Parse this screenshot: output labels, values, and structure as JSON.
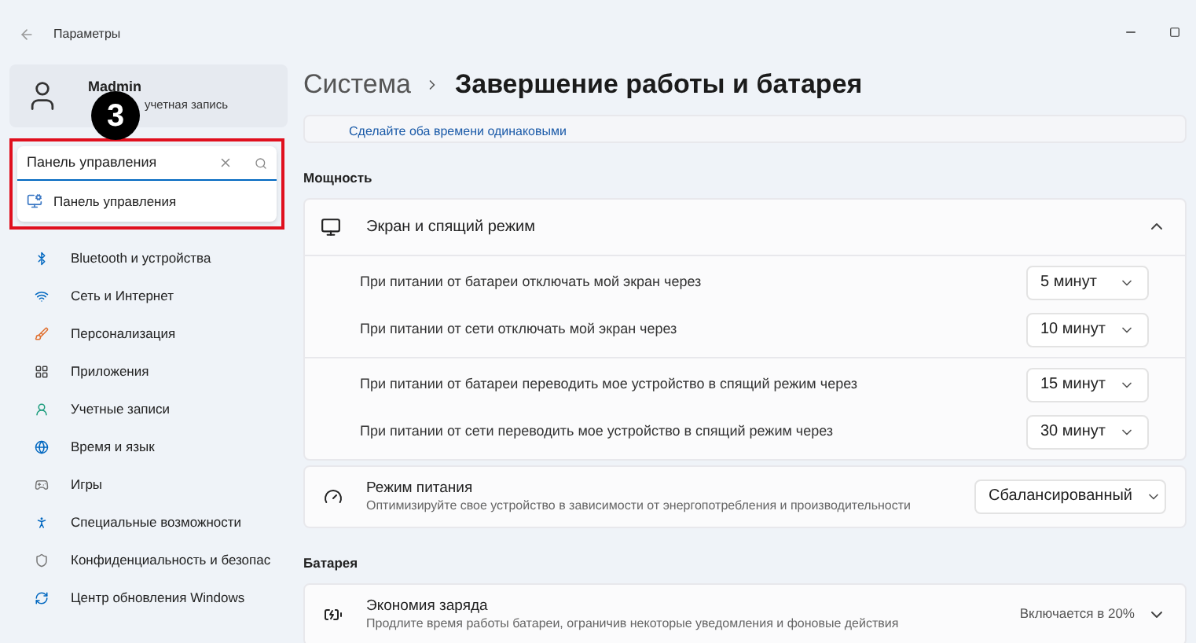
{
  "window": {
    "title": "Параметры"
  },
  "account": {
    "name": "Madmin",
    "subtitle": "учетная запись"
  },
  "step_badge": "3",
  "search": {
    "value": "Панель управления",
    "suggestions": [
      "Панель управления"
    ]
  },
  "nav": [
    {
      "label": "Bluetooth и устройства"
    },
    {
      "label": "Сеть и Интернет"
    },
    {
      "label": "Персонализация"
    },
    {
      "label": "Приложения"
    },
    {
      "label": "Учетные записи"
    },
    {
      "label": "Время и язык"
    },
    {
      "label": "Игры"
    },
    {
      "label": "Специальные возможности"
    },
    {
      "label": "Конфиденциальность и безопас"
    },
    {
      "label": "Центр обновления Windows"
    }
  ],
  "breadcrumb": {
    "parent": "Система",
    "current": "Завершение работы и батарея"
  },
  "link": "Сделайте оба времени одинаковыми",
  "sections": [
    {
      "title": "Мощность",
      "cards": [
        {
          "kind": "expander",
          "title": "Экран и спящий режим",
          "expanded": true,
          "groups": [
            [
              {
                "label": "При питании от батареи отключать мой экран через",
                "value": "5 минут"
              },
              {
                "label": "При питании от сети отключать мой экран через",
                "value": "10 минут"
              }
            ],
            [
              {
                "label": "При питании от батареи переводить мое устройство в спящий режим через",
                "value": "15 минут"
              },
              {
                "label": "При питании от сети переводить мое устройство в спящий режим через",
                "value": "30 минут"
              }
            ]
          ]
        },
        {
          "kind": "select",
          "title": "Режим питания",
          "description": "Оптимизируйте свое устройство в зависимости от энергопотребления и производительности",
          "value": "Сбалансированный"
        }
      ]
    },
    {
      "title": "Батарея",
      "cards": [
        {
          "kind": "status",
          "title": "Экономия заряда",
          "description": "Продлите время работы батареи, ограничив некоторые уведомления и фоновые действия",
          "value": "Включается в 20%",
          "expanded": false
        }
      ]
    }
  ]
}
